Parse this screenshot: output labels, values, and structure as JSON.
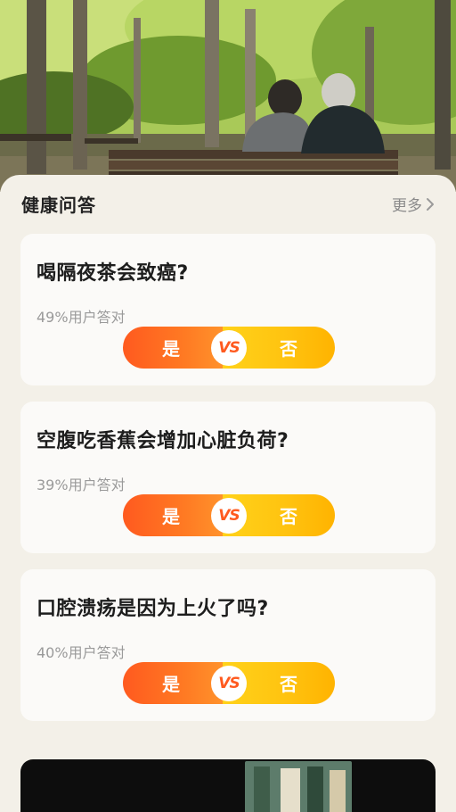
{
  "section": {
    "title": "健康问答",
    "more_label": "更多"
  },
  "questions": [
    {
      "question": "喝隔夜茶会致癌?",
      "stat": "49%用户答对",
      "yes": "是",
      "vs": "VS",
      "no": "否"
    },
    {
      "question": "空腹吃香蕉会增加心脏负荷?",
      "stat": "39%用户答对",
      "yes": "是",
      "vs": "VS",
      "no": "否"
    },
    {
      "question": "口腔溃疡是因为上火了吗?",
      "stat": "40%用户答对",
      "yes": "是",
      "vs": "VS",
      "no": "否"
    }
  ],
  "colors": {
    "yes_gradient_start": "#ff5a1f",
    "no_gradient_start": "#ffd21a",
    "vs_text": "#ff5a1f"
  },
  "icons": {
    "more": "chevron-right-icon"
  }
}
